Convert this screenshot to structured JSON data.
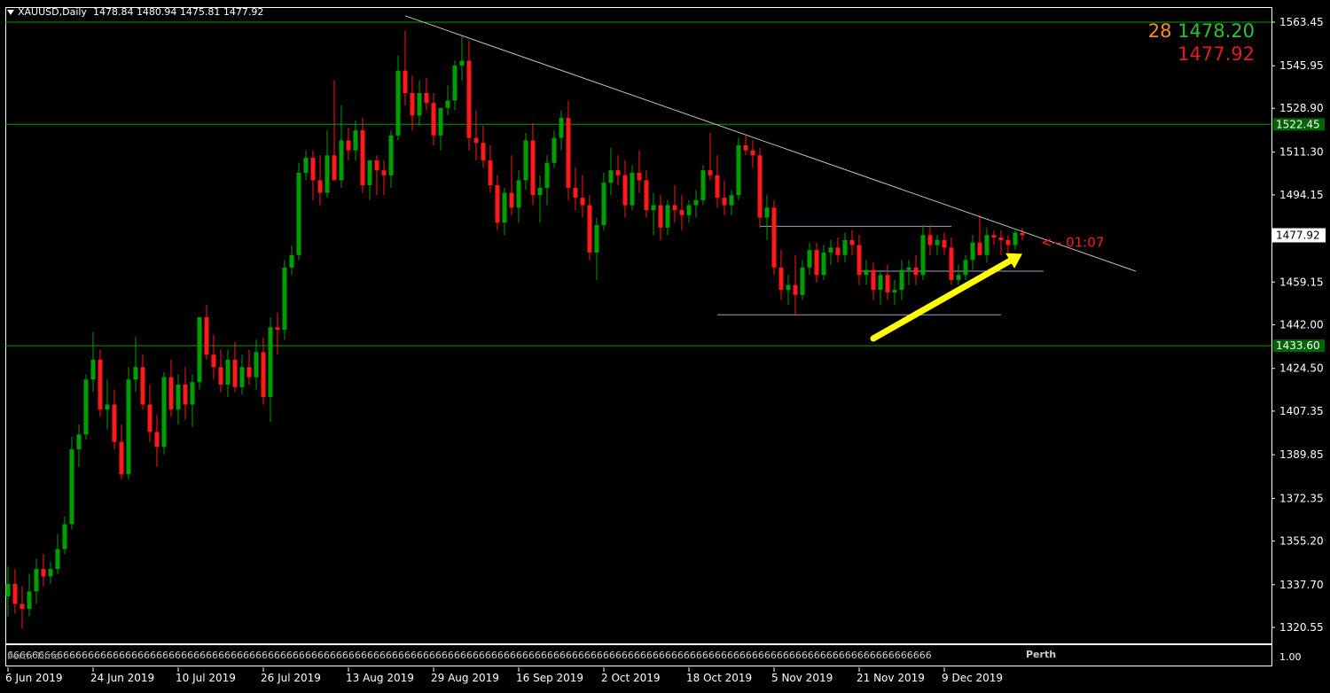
{
  "header": {
    "title": "XAUUSD,Daily",
    "ohlc": "1478.84 1480.94 1475.81 1477.92"
  },
  "quotes": {
    "count": "28",
    "bid": "1478.20",
    "ask": "1477.92"
  },
  "countdown": "<-- 01:07",
  "indicator": {
    "repeat_text": "66666666666666666666666666666666666666666666666666666666666666666666666666666666666666666666666666666666666666666666666666666666666666666666666666666",
    "overlap_label": "Perth Time",
    "name": "Perth",
    "scale_label": "1.00"
  },
  "colors": {
    "bull": "#00a000",
    "bear": "#ff1a1a",
    "grid": "#00a000",
    "axis": "#ffffff",
    "trend": "#c0c0c0",
    "arrow": "#ffff00"
  },
  "chart_data": {
    "type": "candlestick",
    "symbol": "XAUUSD",
    "timeframe": "Daily",
    "ylim": [
      1314,
      1570
    ],
    "y_ticks": [
      "1563.45",
      "1545.95",
      "1528.90",
      "1511.30",
      "1494.15",
      "1476.65",
      "1459.15",
      "1442.00",
      "1424.50",
      "1407.35",
      "1389.85",
      "1372.35",
      "1355.20",
      "1337.70",
      "1320.55"
    ],
    "x_ticks": [
      {
        "label": "6 Jun 2019",
        "index": 0
      },
      {
        "label": "24 Jun 2019",
        "index": 12
      },
      {
        "label": "10 Jul 2019",
        "index": 24
      },
      {
        "label": "26 Jul 2019",
        "index": 36
      },
      {
        "label": "13 Aug 2019",
        "index": 48
      },
      {
        "label": "29 Aug 2019",
        "index": 60
      },
      {
        "label": "16 Sep 2019",
        "index": 72
      },
      {
        "label": "2 Oct 2019",
        "index": 84
      },
      {
        "label": "18 Oct 2019",
        "index": 96
      },
      {
        "label": "5 Nov 2019",
        "index": 108
      },
      {
        "label": "21 Nov 2019",
        "index": 120
      },
      {
        "label": "9 Dec 2019",
        "index": 132
      }
    ],
    "current_price": "1477.92",
    "horizontal_lines": [
      {
        "price": 1522.45,
        "label": "1522.45"
      },
      {
        "price": 1433.6,
        "label": "1433.60"
      },
      {
        "price": 1563.45,
        "label": ""
      }
    ],
    "support_lines": [
      {
        "price": 1481.5,
        "from_index": 106,
        "to_index": 133
      },
      {
        "price": 1463.5,
        "from_index": 120,
        "to_index": 146
      },
      {
        "price": 1446.0,
        "from_index": 100,
        "to_index": 140
      }
    ],
    "trendline": {
      "from": {
        "index": 56,
        "price": 1566.0
      },
      "to": {
        "index": 159,
        "price": 1463.5
      }
    },
    "arrow": {
      "from": {
        "index": 122,
        "price": 1436.5
      },
      "to": {
        "index": 143,
        "price": 1470.5
      }
    },
    "candles": [
      {
        "o": 1333.0,
        "h": 1345.0,
        "l": 1325.0,
        "c": 1338.0
      },
      {
        "o": 1338.0,
        "h": 1344.0,
        "l": 1326.0,
        "c": 1330.0
      },
      {
        "o": 1330.0,
        "h": 1337.0,
        "l": 1320.0,
        "c": 1328.0
      },
      {
        "o": 1328.0,
        "h": 1342.0,
        "l": 1325.0,
        "c": 1335.0
      },
      {
        "o": 1335.0,
        "h": 1348.0,
        "l": 1330.0,
        "c": 1344.0
      },
      {
        "o": 1344.0,
        "h": 1350.0,
        "l": 1337.0,
        "c": 1341.0
      },
      {
        "o": 1341.0,
        "h": 1347.0,
        "l": 1338.0,
        "c": 1344.0
      },
      {
        "o": 1344.0,
        "h": 1358.0,
        "l": 1342.0,
        "c": 1352.0
      },
      {
        "o": 1352.0,
        "h": 1365.0,
        "l": 1350.0,
        "c": 1362.0
      },
      {
        "o": 1362.0,
        "h": 1397.0,
        "l": 1360.0,
        "c": 1392.0
      },
      {
        "o": 1392.0,
        "h": 1402.0,
        "l": 1385.0,
        "c": 1398.0
      },
      {
        "o": 1398.0,
        "h": 1422.0,
        "l": 1396.0,
        "c": 1420.0
      },
      {
        "o": 1420.0,
        "h": 1439.0,
        "l": 1415.0,
        "c": 1428.0
      },
      {
        "o": 1428.0,
        "h": 1432.0,
        "l": 1405.0,
        "c": 1408.0
      },
      {
        "o": 1408.0,
        "h": 1420.0,
        "l": 1400.0,
        "c": 1410.0
      },
      {
        "o": 1410.0,
        "h": 1416.0,
        "l": 1392.0,
        "c": 1395.0
      },
      {
        "o": 1395.0,
        "h": 1402.0,
        "l": 1380.0,
        "c": 1382.0
      },
      {
        "o": 1382.0,
        "h": 1425.0,
        "l": 1380.0,
        "c": 1420.0
      },
      {
        "o": 1420.0,
        "h": 1437.0,
        "l": 1415.0,
        "c": 1425.0
      },
      {
        "o": 1425.0,
        "h": 1430.0,
        "l": 1408.0,
        "c": 1410.0
      },
      {
        "o": 1410.0,
        "h": 1418.0,
        "l": 1395.0,
        "c": 1399.0
      },
      {
        "o": 1399.0,
        "h": 1406.0,
        "l": 1385.0,
        "c": 1393.0
      },
      {
        "o": 1393.0,
        "h": 1423.0,
        "l": 1390.0,
        "c": 1421.0
      },
      {
        "o": 1421.0,
        "h": 1428.0,
        "l": 1405.0,
        "c": 1408.0
      },
      {
        "o": 1408.0,
        "h": 1422.0,
        "l": 1402.0,
        "c": 1418.0
      },
      {
        "o": 1418.0,
        "h": 1425.0,
        "l": 1404.0,
        "c": 1410.0
      },
      {
        "o": 1410.0,
        "h": 1422.0,
        "l": 1401.0,
        "c": 1419.0
      },
      {
        "o": 1419.0,
        "h": 1436.0,
        "l": 1416.0,
        "c": 1445.0
      },
      {
        "o": 1445.0,
        "h": 1450.0,
        "l": 1428.0,
        "c": 1430.0
      },
      {
        "o": 1430.0,
        "h": 1438.0,
        "l": 1420.0,
        "c": 1425.0
      },
      {
        "o": 1425.0,
        "h": 1432.0,
        "l": 1415.0,
        "c": 1418.0
      },
      {
        "o": 1418.0,
        "h": 1432.0,
        "l": 1413.0,
        "c": 1428.0
      },
      {
        "o": 1428.0,
        "h": 1435.0,
        "l": 1415.0,
        "c": 1417.0
      },
      {
        "o": 1417.0,
        "h": 1430.0,
        "l": 1414.0,
        "c": 1425.0
      },
      {
        "o": 1425.0,
        "h": 1432.0,
        "l": 1418.0,
        "c": 1421.0
      },
      {
        "o": 1421.0,
        "h": 1436.0,
        "l": 1416.0,
        "c": 1431.0
      },
      {
        "o": 1431.0,
        "h": 1437.0,
        "l": 1410.0,
        "c": 1413.0
      },
      {
        "o": 1413.0,
        "h": 1445.0,
        "l": 1403.0,
        "c": 1441.0
      },
      {
        "o": 1441.0,
        "h": 1447.0,
        "l": 1430.0,
        "c": 1440.0
      },
      {
        "o": 1440.0,
        "h": 1468.0,
        "l": 1436.0,
        "c": 1465.0
      },
      {
        "o": 1465.0,
        "h": 1474.0,
        "l": 1462.0,
        "c": 1470.0
      },
      {
        "o": 1470.0,
        "h": 1507.0,
        "l": 1468.0,
        "c": 1503.0
      },
      {
        "o": 1503.0,
        "h": 1512.0,
        "l": 1500.0,
        "c": 1509.0
      },
      {
        "o": 1509.0,
        "h": 1512.0,
        "l": 1492.0,
        "c": 1500.0
      },
      {
        "o": 1500.0,
        "h": 1510.0,
        "l": 1490.0,
        "c": 1495.0
      },
      {
        "o": 1495.0,
        "h": 1520.0,
        "l": 1493.0,
        "c": 1510.0
      },
      {
        "o": 1510.0,
        "h": 1540.0,
        "l": 1508.0,
        "c": 1500.0
      },
      {
        "o": 1500.0,
        "h": 1530.0,
        "l": 1497.0,
        "c": 1516.0
      },
      {
        "o": 1516.0,
        "h": 1521.0,
        "l": 1508.0,
        "c": 1512.0
      },
      {
        "o": 1512.0,
        "h": 1524.0,
        "l": 1508.0,
        "c": 1520.0
      },
      {
        "o": 1520.0,
        "h": 1525.0,
        "l": 1495.0,
        "c": 1498.0
      },
      {
        "o": 1498.0,
        "h": 1503.0,
        "l": 1492.0,
        "c": 1508.0
      },
      {
        "o": 1508.0,
        "h": 1510.0,
        "l": 1494.0,
        "c": 1504.0
      },
      {
        "o": 1504.0,
        "h": 1508.0,
        "l": 1494.0,
        "c": 1502.0
      },
      {
        "o": 1502.0,
        "h": 1520.0,
        "l": 1497.0,
        "c": 1518.0
      },
      {
        "o": 1518.0,
        "h": 1550.0,
        "l": 1516.0,
        "c": 1544.0
      },
      {
        "o": 1544.0,
        "h": 1560.0,
        "l": 1530.0,
        "c": 1535.0
      },
      {
        "o": 1535.0,
        "h": 1542.0,
        "l": 1520.0,
        "c": 1526.0
      },
      {
        "o": 1526.0,
        "h": 1540.0,
        "l": 1522.0,
        "c": 1535.0
      },
      {
        "o": 1535.0,
        "h": 1541.0,
        "l": 1528.0,
        "c": 1531.0
      },
      {
        "o": 1531.0,
        "h": 1535.0,
        "l": 1514.0,
        "c": 1518.0
      },
      {
        "o": 1518.0,
        "h": 1524.0,
        "l": 1512.0,
        "c": 1529.0
      },
      {
        "o": 1529.0,
        "h": 1538.0,
        "l": 1526.0,
        "c": 1532.0
      },
      {
        "o": 1532.0,
        "h": 1548.0,
        "l": 1528.0,
        "c": 1546.0
      },
      {
        "o": 1546.0,
        "h": 1558.0,
        "l": 1540.0,
        "c": 1548.0
      },
      {
        "o": 1548.0,
        "h": 1556.0,
        "l": 1512.0,
        "c": 1517.0
      },
      {
        "o": 1517.0,
        "h": 1528.0,
        "l": 1508.0,
        "c": 1515.0
      },
      {
        "o": 1515.0,
        "h": 1522.0,
        "l": 1505.0,
        "c": 1508.0
      },
      {
        "o": 1508.0,
        "h": 1514.0,
        "l": 1495.0,
        "c": 1498.0
      },
      {
        "o": 1498.0,
        "h": 1502.0,
        "l": 1480.0,
        "c": 1483.0
      },
      {
        "o": 1483.0,
        "h": 1497.0,
        "l": 1478.0,
        "c": 1495.0
      },
      {
        "o": 1495.0,
        "h": 1510.0,
        "l": 1486.0,
        "c": 1489.0
      },
      {
        "o": 1489.0,
        "h": 1504.0,
        "l": 1483.0,
        "c": 1500.0
      },
      {
        "o": 1500.0,
        "h": 1519.0,
        "l": 1496.0,
        "c": 1516.0
      },
      {
        "o": 1516.0,
        "h": 1523.0,
        "l": 1490.0,
        "c": 1494.0
      },
      {
        "o": 1494.0,
        "h": 1502.0,
        "l": 1483.0,
        "c": 1497.0
      },
      {
        "o": 1497.0,
        "h": 1510.0,
        "l": 1490.0,
        "c": 1507.0
      },
      {
        "o": 1507.0,
        "h": 1520.0,
        "l": 1505.0,
        "c": 1517.0
      },
      {
        "o": 1517.0,
        "h": 1528.0,
        "l": 1512.0,
        "c": 1525.0
      },
      {
        "o": 1525.0,
        "h": 1532.0,
        "l": 1492.0,
        "c": 1497.0
      },
      {
        "o": 1497.0,
        "h": 1505.0,
        "l": 1488.0,
        "c": 1493.0
      },
      {
        "o": 1493.0,
        "h": 1502.0,
        "l": 1485.0,
        "c": 1490.0
      },
      {
        "o": 1490.0,
        "h": 1494.0,
        "l": 1468.0,
        "c": 1471.0
      },
      {
        "o": 1471.0,
        "h": 1485.0,
        "l": 1460.0,
        "c": 1482.0
      },
      {
        "o": 1482.0,
        "h": 1503.0,
        "l": 1480.0,
        "c": 1499.0
      },
      {
        "o": 1499.0,
        "h": 1513.0,
        "l": 1494.0,
        "c": 1504.0
      },
      {
        "o": 1504.0,
        "h": 1510.0,
        "l": 1498.0,
        "c": 1502.0
      },
      {
        "o": 1502.0,
        "h": 1508.0,
        "l": 1485.0,
        "c": 1490.0
      },
      {
        "o": 1490.0,
        "h": 1506.0,
        "l": 1488.0,
        "c": 1503.0
      },
      {
        "o": 1503.0,
        "h": 1512.0,
        "l": 1495.0,
        "c": 1500.0
      },
      {
        "o": 1500.0,
        "h": 1504.0,
        "l": 1485.0,
        "c": 1488.0
      },
      {
        "o": 1488.0,
        "h": 1495.0,
        "l": 1478.0,
        "c": 1490.0
      },
      {
        "o": 1490.0,
        "h": 1494.0,
        "l": 1476.0,
        "c": 1481.0
      },
      {
        "o": 1481.0,
        "h": 1492.0,
        "l": 1478.0,
        "c": 1490.0
      },
      {
        "o": 1490.0,
        "h": 1498.0,
        "l": 1483.0,
        "c": 1488.0
      },
      {
        "o": 1488.0,
        "h": 1494.0,
        "l": 1480.0,
        "c": 1486.0
      },
      {
        "o": 1486.0,
        "h": 1492.0,
        "l": 1483.0,
        "c": 1490.0
      },
      {
        "o": 1490.0,
        "h": 1496.0,
        "l": 1485.0,
        "c": 1492.0
      },
      {
        "o": 1492.0,
        "h": 1506.0,
        "l": 1490.0,
        "c": 1504.0
      },
      {
        "o": 1504.0,
        "h": 1519.0,
        "l": 1500.0,
        "c": 1502.0
      },
      {
        "o": 1502.0,
        "h": 1510.0,
        "l": 1489.0,
        "c": 1493.0
      },
      {
        "o": 1493.0,
        "h": 1500.0,
        "l": 1486.0,
        "c": 1490.0
      },
      {
        "o": 1490.0,
        "h": 1496.0,
        "l": 1486.0,
        "c": 1494.0
      },
      {
        "o": 1494.0,
        "h": 1517.0,
        "l": 1492.0,
        "c": 1514.0
      },
      {
        "o": 1514.0,
        "h": 1518.0,
        "l": 1510.0,
        "c": 1512.0
      },
      {
        "o": 1512.0,
        "h": 1516.0,
        "l": 1505.0,
        "c": 1510.0
      },
      {
        "o": 1510.0,
        "h": 1513.0,
        "l": 1481.0,
        "c": 1485.0
      },
      {
        "o": 1485.0,
        "h": 1494.0,
        "l": 1476.0,
        "c": 1489.0
      },
      {
        "o": 1489.0,
        "h": 1492.0,
        "l": 1462.0,
        "c": 1465.0
      },
      {
        "o": 1465.0,
        "h": 1472.0,
        "l": 1452.0,
        "c": 1456.0
      },
      {
        "o": 1456.0,
        "h": 1462.0,
        "l": 1450.0,
        "c": 1458.0
      },
      {
        "o": 1458.0,
        "h": 1470.0,
        "l": 1446.0,
        "c": 1454.0
      },
      {
        "o": 1454.0,
        "h": 1468.0,
        "l": 1452.0,
        "c": 1465.0
      },
      {
        "o": 1465.0,
        "h": 1475.0,
        "l": 1462.0,
        "c": 1472.0
      },
      {
        "o": 1472.0,
        "h": 1475.0,
        "l": 1459.0,
        "c": 1462.0
      },
      {
        "o": 1462.0,
        "h": 1474.0,
        "l": 1460.0,
        "c": 1471.0
      },
      {
        "o": 1471.0,
        "h": 1476.0,
        "l": 1466.0,
        "c": 1473.0
      },
      {
        "o": 1473.0,
        "h": 1477.0,
        "l": 1467.0,
        "c": 1470.0
      },
      {
        "o": 1470.0,
        "h": 1479.0,
        "l": 1467.0,
        "c": 1476.0
      },
      {
        "o": 1476.0,
        "h": 1480.0,
        "l": 1470.0,
        "c": 1474.0
      },
      {
        "o": 1474.0,
        "h": 1478.0,
        "l": 1458.0,
        "c": 1462.0
      },
      {
        "o": 1462.0,
        "h": 1468.0,
        "l": 1458.0,
        "c": 1464.0
      },
      {
        "o": 1464.0,
        "h": 1467.0,
        "l": 1452.0,
        "c": 1456.0
      },
      {
        "o": 1456.0,
        "h": 1464.0,
        "l": 1450.0,
        "c": 1462.0
      },
      {
        "o": 1462.0,
        "h": 1466.0,
        "l": 1452.0,
        "c": 1455.0
      },
      {
        "o": 1455.0,
        "h": 1460.0,
        "l": 1450.0,
        "c": 1456.0
      },
      {
        "o": 1456.0,
        "h": 1468.0,
        "l": 1452.0,
        "c": 1464.0
      },
      {
        "o": 1464.0,
        "h": 1468.0,
        "l": 1458.0,
        "c": 1465.0
      },
      {
        "o": 1465.0,
        "h": 1470.0,
        "l": 1458.0,
        "c": 1462.0
      },
      {
        "o": 1462.0,
        "h": 1482.0,
        "l": 1460.0,
        "c": 1478.0
      },
      {
        "o": 1478.0,
        "h": 1482.0,
        "l": 1470.0,
        "c": 1474.0
      },
      {
        "o": 1474.0,
        "h": 1478.0,
        "l": 1470.0,
        "c": 1476.0
      },
      {
        "o": 1476.0,
        "h": 1479.0,
        "l": 1470.0,
        "c": 1473.0
      },
      {
        "o": 1473.0,
        "h": 1477.0,
        "l": 1458.0,
        "c": 1460.0
      },
      {
        "o": 1460.0,
        "h": 1466.0,
        "l": 1458.0,
        "c": 1462.0
      },
      {
        "o": 1462.0,
        "h": 1470.0,
        "l": 1460.0,
        "c": 1468.0
      },
      {
        "o": 1468.0,
        "h": 1478.0,
        "l": 1464.0,
        "c": 1475.0
      },
      {
        "o": 1475.0,
        "h": 1486.0,
        "l": 1470.0,
        "c": 1470.0
      },
      {
        "o": 1470.0,
        "h": 1481.0,
        "l": 1467.0,
        "c": 1478.0
      },
      {
        "o": 1478.0,
        "h": 1480.0,
        "l": 1474.0,
        "c": 1477.0
      },
      {
        "o": 1477.0,
        "h": 1480.0,
        "l": 1470.0,
        "c": 1476.0
      },
      {
        "o": 1476.0,
        "h": 1478.0,
        "l": 1471.0,
        "c": 1474.0
      },
      {
        "o": 1474.0,
        "h": 1480.0,
        "l": 1472.0,
        "c": 1479.0
      },
      {
        "o": 1478.84,
        "h": 1480.94,
        "l": 1475.81,
        "c": 1477.92
      }
    ]
  }
}
